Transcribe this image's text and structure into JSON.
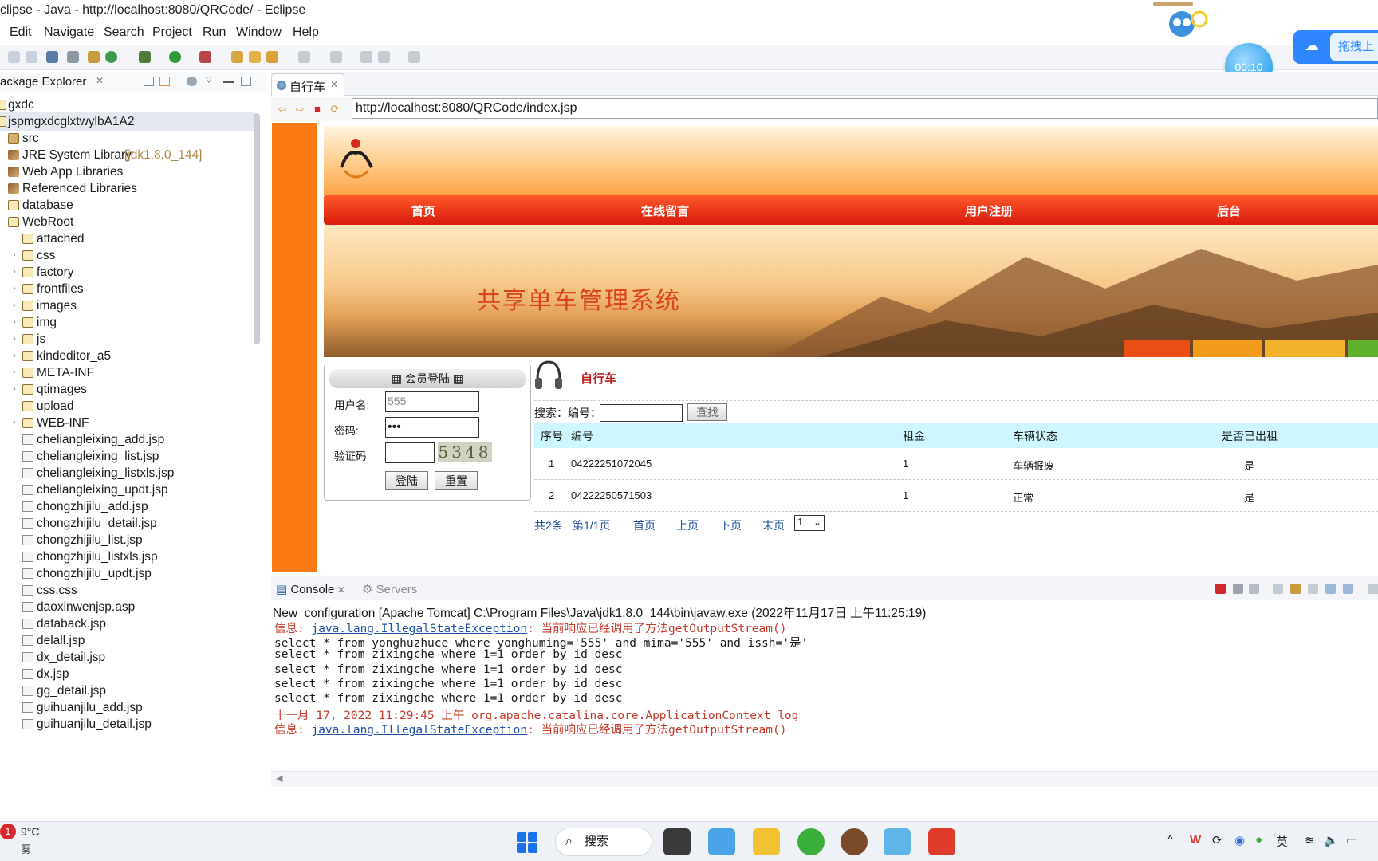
{
  "window": {
    "title": "clipse - Java - http://localhost:8080/QRCode/ - Eclipse"
  },
  "menu": [
    "Edit",
    "Navigate",
    "Search",
    "Project",
    "Run",
    "Window",
    "Help"
  ],
  "overlay": {
    "timer": "00:10",
    "baidu_label": "拖拽上"
  },
  "package_explorer": {
    "title": "ackage Explorer",
    "items": [
      {
        "label": "gxdc",
        "icon": "project-icon"
      },
      {
        "label": "jspmgxdcglxtwylbA1A2",
        "icon": "project-icon"
      },
      {
        "label": "src",
        "icon": "source-folder-icon"
      },
      {
        "label": "JRE System Library",
        "decoration": "[jdk1.8.0_144]",
        "icon": "library-icon"
      },
      {
        "label": "Web App Libraries",
        "icon": "library-icon"
      },
      {
        "label": "Referenced Libraries",
        "icon": "library-icon"
      },
      {
        "label": "database",
        "icon": "folder-icon"
      },
      {
        "label": "WebRoot",
        "icon": "folder-icon"
      },
      {
        "label": "attached",
        "icon": "folder-icon"
      },
      {
        "label": "css",
        "icon": "folder-icon"
      },
      {
        "label": "factory",
        "icon": "folder-icon"
      },
      {
        "label": "frontfiles",
        "icon": "folder-icon"
      },
      {
        "label": "images",
        "icon": "folder-icon"
      },
      {
        "label": "img",
        "icon": "folder-icon"
      },
      {
        "label": "js",
        "icon": "folder-icon"
      },
      {
        "label": "kindeditor_a5",
        "icon": "folder-icon"
      },
      {
        "label": "META-INF",
        "icon": "folder-icon"
      },
      {
        "label": "qtimages",
        "icon": "folder-icon"
      },
      {
        "label": "upload",
        "icon": "folder-icon"
      },
      {
        "label": "WEB-INF",
        "icon": "folder-icon"
      },
      {
        "label": "cheliangleixing_add.jsp",
        "icon": "file-icon"
      },
      {
        "label": "cheliangleixing_list.jsp",
        "icon": "file-icon"
      },
      {
        "label": "cheliangleixing_listxls.jsp",
        "icon": "file-icon"
      },
      {
        "label": "cheliangleixing_updt.jsp",
        "icon": "file-icon"
      },
      {
        "label": "chongzhijilu_add.jsp",
        "icon": "file-icon"
      },
      {
        "label": "chongzhijilu_detail.jsp",
        "icon": "file-icon"
      },
      {
        "label": "chongzhijilu_list.jsp",
        "icon": "file-icon"
      },
      {
        "label": "chongzhijilu_listxls.jsp",
        "icon": "file-icon"
      },
      {
        "label": "chongzhijilu_updt.jsp",
        "icon": "file-icon"
      },
      {
        "label": "css.css",
        "icon": "file-icon"
      },
      {
        "label": "daoxinwenjsp.asp",
        "icon": "file-icon"
      },
      {
        "label": "databack.jsp",
        "icon": "file-icon"
      },
      {
        "label": "delall.jsp",
        "icon": "file-icon"
      },
      {
        "label": "dx_detail.jsp",
        "icon": "file-icon"
      },
      {
        "label": "dx.jsp",
        "icon": "file-icon"
      },
      {
        "label": "gg_detail.jsp",
        "icon": "file-icon"
      },
      {
        "label": "guihuanjilu_add.jsp",
        "icon": "file-icon"
      },
      {
        "label": "guihuanjilu_detail.jsp",
        "icon": "file-icon"
      }
    ]
  },
  "editor": {
    "tab_label": "自行车",
    "url": "http://localhost:8080/QRCode/index.jsp"
  },
  "website": {
    "nav": [
      "首页",
      "在线留言",
      "用户注册",
      "后台"
    ],
    "hero_title": "共享单车管理系统",
    "login": {
      "header": "会员登陆",
      "username_label": "用户名:",
      "username_value": "555",
      "password_label": "密码:",
      "password_value": "•••",
      "captcha_label": "验证码",
      "captcha_text": "5348",
      "login_button": "登陆",
      "reset_button": "重置"
    },
    "section_title": "自行车",
    "search": {
      "label": "搜索：编号：",
      "button": "查找"
    },
    "table": {
      "headers": [
        "序号",
        "编号",
        "租金",
        "车辆状态",
        "是否已出租"
      ],
      "rows": [
        [
          "1",
          "04222251072045",
          "1",
          "车辆报废",
          "是"
        ],
        [
          "2",
          "04222250571503",
          "1",
          "正常",
          "是"
        ]
      ]
    },
    "pager": {
      "total": "共2条",
      "page": "第1/1页",
      "first": "首页",
      "prev": "上页",
      "next": "下页",
      "last": "末页",
      "select_value": "1"
    }
  },
  "console": {
    "tab_console": "Console",
    "tab_servers": "Servers",
    "meta": "New_configuration [Apache Tomcat] C:\\Program Files\\Java\\jdk1.8.0_144\\bin\\javaw.exe (2022年11月17日 上午11:25:19)",
    "lines": [
      {
        "prefix": "信息: ",
        "link": "java.lang.IllegalStateException",
        "suffix": ": 当前响应已经调用了方法getOutputStream()",
        "color": "red"
      },
      {
        "text": "select * from yonghuzhuce where yonghuming='555' and mima='555' and issh='是'",
        "color": "black"
      },
      {
        "text": "select * from zixingche where 1=1 order by id desc",
        "color": "black"
      },
      {
        "text": "select * from zixingche where 1=1 order by id desc",
        "color": "black"
      },
      {
        "text": "select * from zixingche where 1=1 order by id desc",
        "color": "black"
      },
      {
        "text": "select * from zixingche where 1=1 order by id desc",
        "color": "black"
      },
      {
        "text": "十一月 17, 2022 11:29:45 上午 org.apache.catalina.core.ApplicationContext log",
        "color": "red"
      },
      {
        "prefix": "信息: ",
        "link": "java.lang.IllegalStateException",
        "suffix": ": 当前响应已经调用了方法getOutputStream()",
        "color": "red"
      }
    ]
  },
  "taskbar": {
    "weather_badge": "1",
    "temperature": "9°C",
    "weather": "雾",
    "search_label": "搜索",
    "ime": "英"
  },
  "colors": {
    "web_orange": "#fb7a14",
    "nav_red": "#d81a0c",
    "table_header": "#cdf6ff",
    "console_error": "#c33a2a",
    "link_blue": "#1f4fa8"
  }
}
